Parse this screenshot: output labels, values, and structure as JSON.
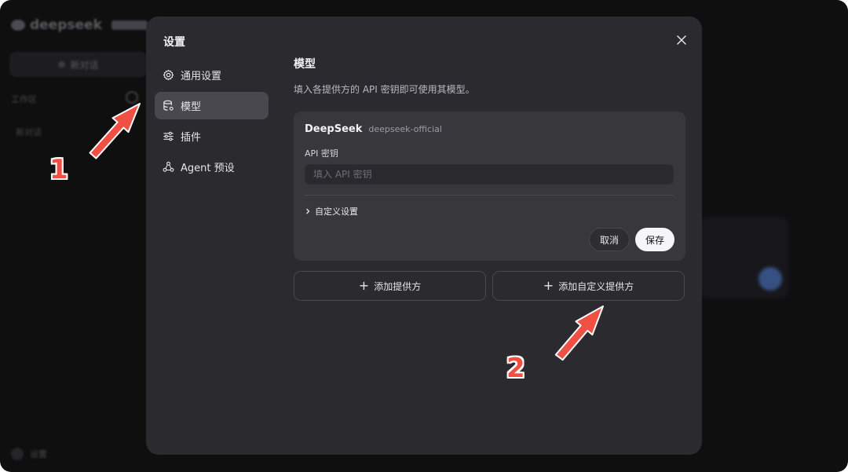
{
  "background_app": {
    "logo_text": "deepseek",
    "new_chat_label": "新对话",
    "section_label": "工作区",
    "history_item": "新对话",
    "settings_label": "设置"
  },
  "dialog": {
    "title": "设置",
    "nav": [
      {
        "label": "通用设置",
        "icon": "gear-icon"
      },
      {
        "label": "模型",
        "icon": "database-icon"
      },
      {
        "label": "插件",
        "icon": "sliders-icon"
      },
      {
        "label": "Agent 预设",
        "icon": "agent-icon"
      }
    ],
    "active_nav": "模型",
    "content": {
      "title": "模型",
      "description": "填入各提供方的 API 密钥即可使用其模型。",
      "provider": {
        "name": "DeepSeek",
        "id": "deepseek-official",
        "api_label": "API 密钥",
        "api_placeholder": "填入 API 密钥",
        "api_value": "",
        "custom_settings_label": "自定义设置",
        "cancel_label": "取消",
        "save_label": "保存"
      },
      "add_provider_label": "添加提供方",
      "add_custom_provider_label": "添加自定义提供方"
    }
  },
  "annotations": {
    "step1": "1",
    "step2": "2"
  },
  "colors": {
    "accent_arrow": "#f04f44",
    "dialog_bg": "#2b2a2e",
    "card_bg": "#38373c",
    "active_nav_bg": "#49484e"
  }
}
